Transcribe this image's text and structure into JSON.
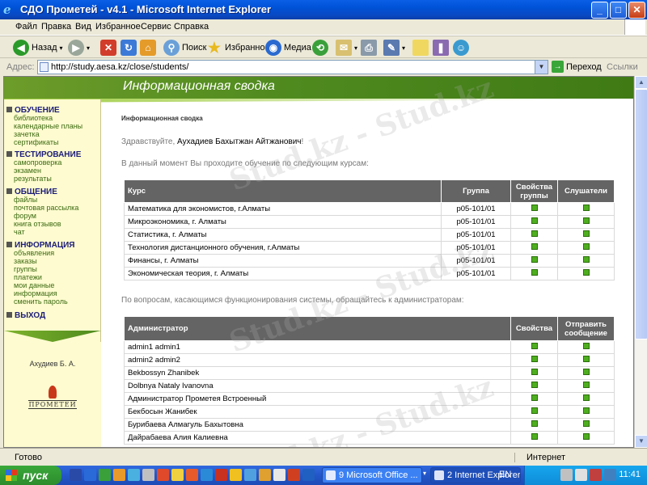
{
  "window": {
    "title": "СДО Прометей - v4.1 - Microsoft Internet Explorer"
  },
  "menu": [
    "Файл",
    "Правка",
    "Вид",
    "Избранное",
    "Сервис",
    "Справка"
  ],
  "toolbar": {
    "back": "Назад",
    "search": "Поиск",
    "favorites": "Избранное",
    "media": "Медиа"
  },
  "address": {
    "label": "Адрес:",
    "url": "http://study.aesa.kz/close/students/",
    "go": "Переход",
    "links": "Ссылки"
  },
  "site": {
    "banner": "Информационная сводка",
    "sidebar": [
      {
        "title": "ОБУЧЕНИЕ",
        "items": [
          "библиотека",
          "календарные планы",
          "зачетка",
          "сертификаты"
        ]
      },
      {
        "title": "ТЕСТИРОВАНИЕ",
        "items": [
          "самопроверка",
          "экзамен",
          "результаты"
        ]
      },
      {
        "title": "ОБЩЕНИЕ",
        "items": [
          "файлы",
          "почтовая рассылка",
          "форум",
          "книга отзывов",
          "чат"
        ]
      },
      {
        "title": "ИНФОРМАЦИЯ",
        "items": [
          "объявления",
          "заказы",
          "группы",
          "платежи",
          "мои данные",
          "информация",
          "сменить пароль"
        ]
      },
      {
        "title": "ВЫХОД",
        "items": []
      }
    ],
    "user_short": "Ахудиев Б. А.",
    "logo_text": "ПРОМЕТЕЙ"
  },
  "main": {
    "breadcrumb": "Информационная сводка",
    "greeting_prefix": "Здравствуйте, ",
    "greeting_name": "Аухадиев Бахытжан Айтжанович",
    "greeting_suffix": "!",
    "courses_intro": "В данный момент Вы проходите обучение по следующим курсам:",
    "courses_headers": {
      "course": "Курс",
      "group": "Группа",
      "props": "Свойства группы",
      "listeners": "Слушатели"
    },
    "courses": [
      {
        "name": "Математика для экономистов, г.Алматы",
        "group": "p05-101/01"
      },
      {
        "name": "Микроэкономика, г. Алматы",
        "group": "p05-101/01"
      },
      {
        "name": "Статистика, г. Алматы",
        "group": "p05-101/01"
      },
      {
        "name": "Технология дистанционного обучения, г.Алматы",
        "group": "p05-101/01"
      },
      {
        "name": "Финансы, г. Алматы",
        "group": "p05-101/01"
      },
      {
        "name": "Экономическая теория, г. Алматы",
        "group": "p05-101/01"
      }
    ],
    "admins_intro": "По вопросам, касающимся функционирования системы, обращайтесь к администраторам:",
    "admins_headers": {
      "admin": "Администратор",
      "props": "Свойства",
      "send": "Отправить сообщение"
    },
    "admins": [
      "admin1 admin1",
      "admin2 admin2",
      "Bekbossyn Zhanibek",
      "Dolbnya Nataly Ivanovna",
      "Администратор Прометея Встроенный",
      "Бекбосын Жанибек",
      "Бурибаева Алмагуль Бахытовна",
      "Дайрабаева Алия Калиевна"
    ]
  },
  "watermark": "Stud.kz - Stud.kz",
  "status": {
    "text": "Готово",
    "zone": "Интернет"
  },
  "taskbar": {
    "start": "пуск",
    "tasks": [
      "9 Microsoft Office ...",
      "2 Internet Explorer"
    ],
    "lang": "EN",
    "clock": "11:41"
  }
}
